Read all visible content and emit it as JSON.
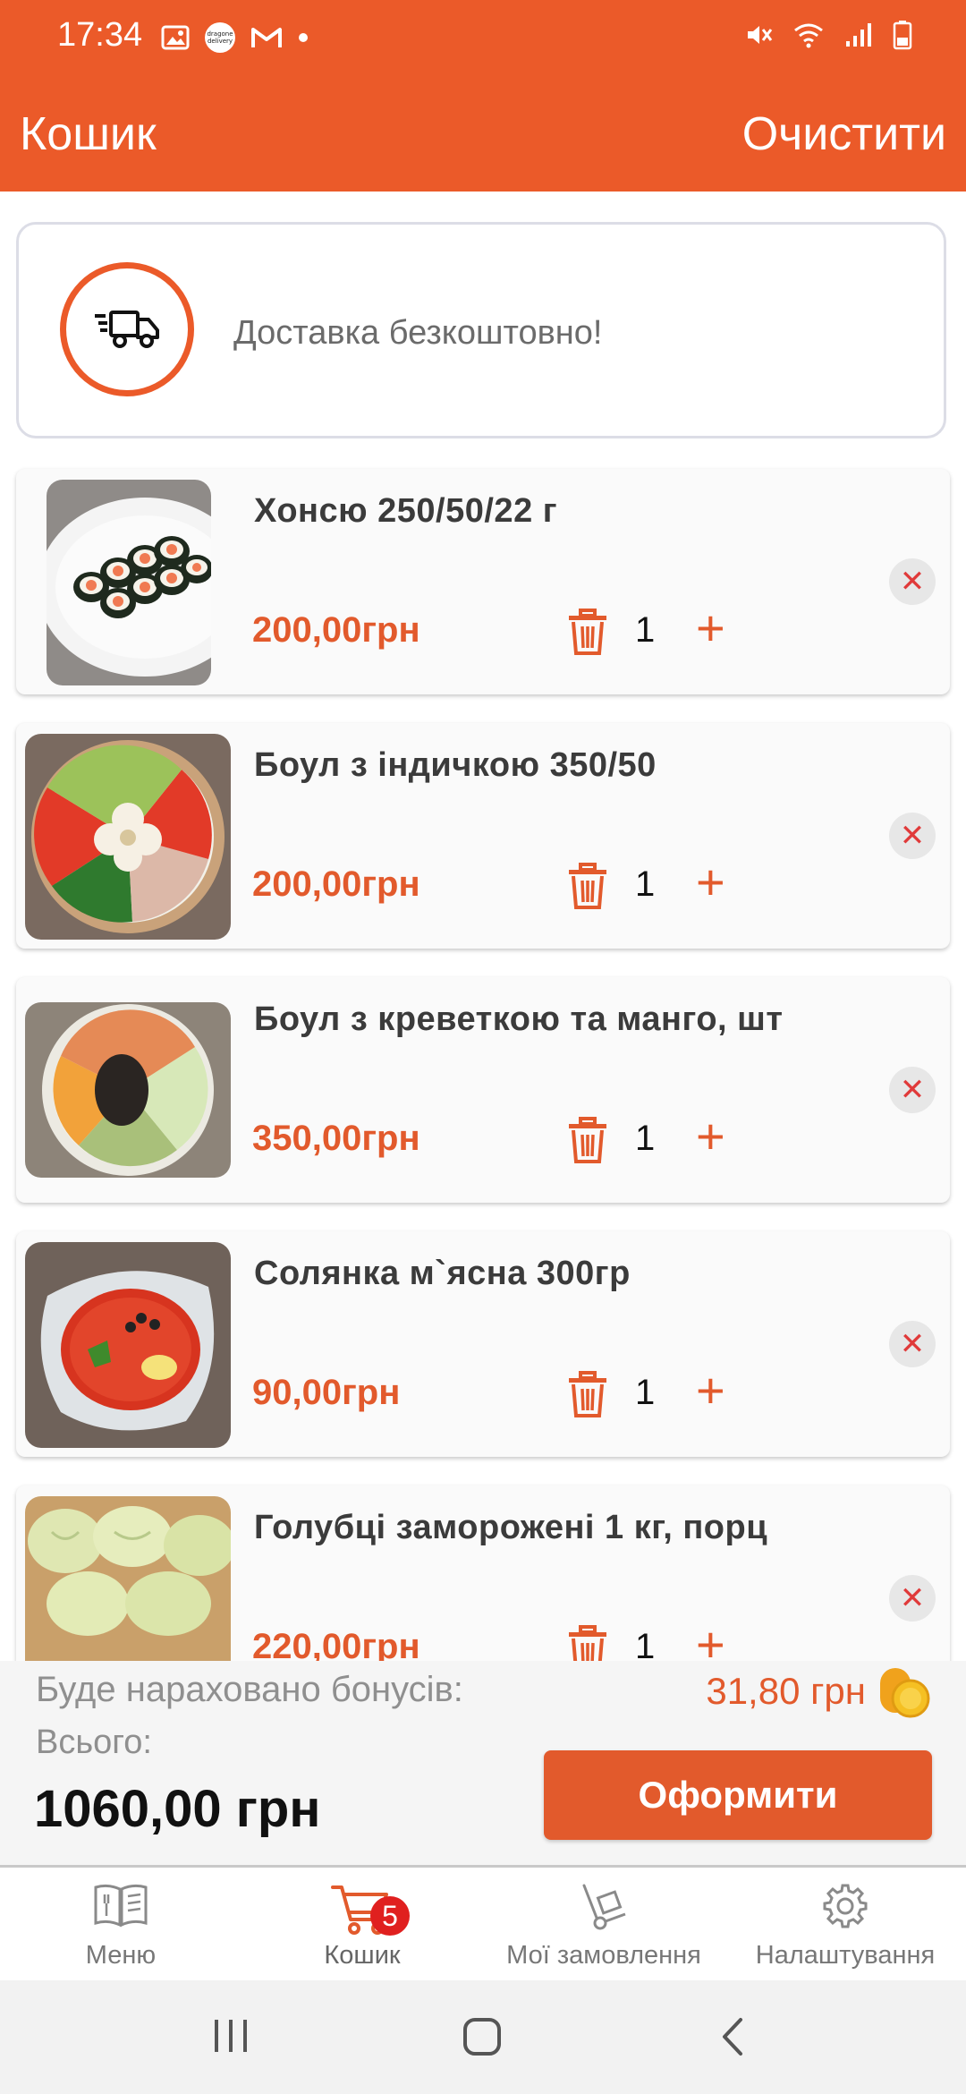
{
  "status_bar": {
    "time": "17:34",
    "delivery_logo_text": "dragone delivery"
  },
  "header": {
    "title": "Кошик",
    "clear_label": "Очистити"
  },
  "delivery_banner": {
    "text": "Доставка безкоштовно!"
  },
  "cart": {
    "items": [
      {
        "name": "Хонсю 250/50/22 г",
        "price": "200,00грн",
        "quantity": "1",
        "image_icon": "sushi-roll-image"
      },
      {
        "name": "Боул з індичкою 350/50",
        "price": "200,00грн",
        "quantity": "1",
        "image_icon": "turkey-bowl-image"
      },
      {
        "name": "Боул  з креветкою та манго, шт",
        "price": "350,00грн",
        "quantity": "1",
        "image_icon": "shrimp-mango-bowl-image"
      },
      {
        "name": "Солянка м`ясна 300гр",
        "price": "90,00грн",
        "quantity": "1",
        "image_icon": "solyanka-soup-image"
      },
      {
        "name": "Голубці заморожені 1 кг, порц",
        "price": "220,00грн",
        "quantity": "1",
        "image_icon": "cabbage-rolls-image"
      }
    ]
  },
  "summary": {
    "bonus_label": "Буде нараховано бонусів:",
    "bonus_value": "31,80 грн",
    "total_label": "Всього:",
    "total_value": "1060,00 грн",
    "checkout_label": "Оформити"
  },
  "tabs": [
    {
      "label": "Меню",
      "icon": "menu-book-icon",
      "active": false
    },
    {
      "label": "Кошик",
      "icon": "cart-icon",
      "active": true,
      "badge": "5"
    },
    {
      "label": "Мої замовлення",
      "icon": "hand-truck-icon",
      "active": false
    },
    {
      "label": "Налаштування",
      "icon": "gear-icon",
      "active": false
    }
  ],
  "colors": {
    "accent": "#EB5A29",
    "price": "#E25A2C",
    "remove": "#E03A3A",
    "badge": "#E0201F"
  }
}
